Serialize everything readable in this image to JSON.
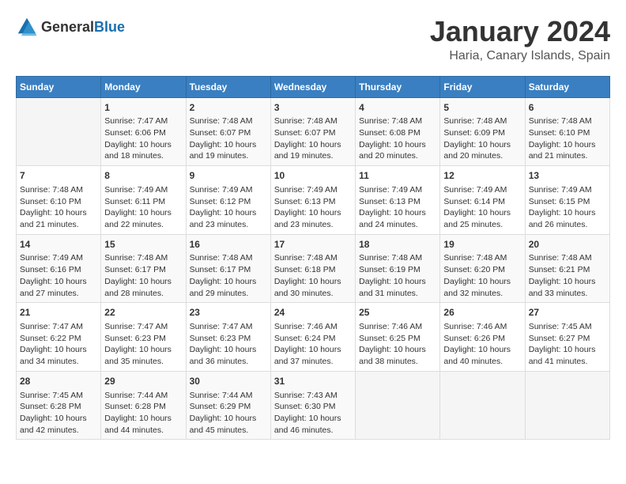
{
  "header": {
    "logo": {
      "general": "General",
      "blue": "Blue"
    },
    "title": "January 2024",
    "subtitle": "Haria, Canary Islands, Spain"
  },
  "weekdays": [
    "Sunday",
    "Monday",
    "Tuesday",
    "Wednesday",
    "Thursday",
    "Friday",
    "Saturday"
  ],
  "weeks": [
    [
      {
        "day": "",
        "info": ""
      },
      {
        "day": "1",
        "info": "Sunrise: 7:47 AM\nSunset: 6:06 PM\nDaylight: 10 hours\nand 18 minutes."
      },
      {
        "day": "2",
        "info": "Sunrise: 7:48 AM\nSunset: 6:07 PM\nDaylight: 10 hours\nand 19 minutes."
      },
      {
        "day": "3",
        "info": "Sunrise: 7:48 AM\nSunset: 6:07 PM\nDaylight: 10 hours\nand 19 minutes."
      },
      {
        "day": "4",
        "info": "Sunrise: 7:48 AM\nSunset: 6:08 PM\nDaylight: 10 hours\nand 20 minutes."
      },
      {
        "day": "5",
        "info": "Sunrise: 7:48 AM\nSunset: 6:09 PM\nDaylight: 10 hours\nand 20 minutes."
      },
      {
        "day": "6",
        "info": "Sunrise: 7:48 AM\nSunset: 6:10 PM\nDaylight: 10 hours\nand 21 minutes."
      }
    ],
    [
      {
        "day": "7",
        "info": "Sunrise: 7:48 AM\nSunset: 6:10 PM\nDaylight: 10 hours\nand 21 minutes."
      },
      {
        "day": "8",
        "info": "Sunrise: 7:49 AM\nSunset: 6:11 PM\nDaylight: 10 hours\nand 22 minutes."
      },
      {
        "day": "9",
        "info": "Sunrise: 7:49 AM\nSunset: 6:12 PM\nDaylight: 10 hours\nand 23 minutes."
      },
      {
        "day": "10",
        "info": "Sunrise: 7:49 AM\nSunset: 6:13 PM\nDaylight: 10 hours\nand 23 minutes."
      },
      {
        "day": "11",
        "info": "Sunrise: 7:49 AM\nSunset: 6:13 PM\nDaylight: 10 hours\nand 24 minutes."
      },
      {
        "day": "12",
        "info": "Sunrise: 7:49 AM\nSunset: 6:14 PM\nDaylight: 10 hours\nand 25 minutes."
      },
      {
        "day": "13",
        "info": "Sunrise: 7:49 AM\nSunset: 6:15 PM\nDaylight: 10 hours\nand 26 minutes."
      }
    ],
    [
      {
        "day": "14",
        "info": "Sunrise: 7:49 AM\nSunset: 6:16 PM\nDaylight: 10 hours\nand 27 minutes."
      },
      {
        "day": "15",
        "info": "Sunrise: 7:48 AM\nSunset: 6:17 PM\nDaylight: 10 hours\nand 28 minutes."
      },
      {
        "day": "16",
        "info": "Sunrise: 7:48 AM\nSunset: 6:17 PM\nDaylight: 10 hours\nand 29 minutes."
      },
      {
        "day": "17",
        "info": "Sunrise: 7:48 AM\nSunset: 6:18 PM\nDaylight: 10 hours\nand 30 minutes."
      },
      {
        "day": "18",
        "info": "Sunrise: 7:48 AM\nSunset: 6:19 PM\nDaylight: 10 hours\nand 31 minutes."
      },
      {
        "day": "19",
        "info": "Sunrise: 7:48 AM\nSunset: 6:20 PM\nDaylight: 10 hours\nand 32 minutes."
      },
      {
        "day": "20",
        "info": "Sunrise: 7:48 AM\nSunset: 6:21 PM\nDaylight: 10 hours\nand 33 minutes."
      }
    ],
    [
      {
        "day": "21",
        "info": "Sunrise: 7:47 AM\nSunset: 6:22 PM\nDaylight: 10 hours\nand 34 minutes."
      },
      {
        "day": "22",
        "info": "Sunrise: 7:47 AM\nSunset: 6:23 PM\nDaylight: 10 hours\nand 35 minutes."
      },
      {
        "day": "23",
        "info": "Sunrise: 7:47 AM\nSunset: 6:23 PM\nDaylight: 10 hours\nand 36 minutes."
      },
      {
        "day": "24",
        "info": "Sunrise: 7:46 AM\nSunset: 6:24 PM\nDaylight: 10 hours\nand 37 minutes."
      },
      {
        "day": "25",
        "info": "Sunrise: 7:46 AM\nSunset: 6:25 PM\nDaylight: 10 hours\nand 38 minutes."
      },
      {
        "day": "26",
        "info": "Sunrise: 7:46 AM\nSunset: 6:26 PM\nDaylight: 10 hours\nand 40 minutes."
      },
      {
        "day": "27",
        "info": "Sunrise: 7:45 AM\nSunset: 6:27 PM\nDaylight: 10 hours\nand 41 minutes."
      }
    ],
    [
      {
        "day": "28",
        "info": "Sunrise: 7:45 AM\nSunset: 6:28 PM\nDaylight: 10 hours\nand 42 minutes."
      },
      {
        "day": "29",
        "info": "Sunrise: 7:44 AM\nSunset: 6:28 PM\nDaylight: 10 hours\nand 44 minutes."
      },
      {
        "day": "30",
        "info": "Sunrise: 7:44 AM\nSunset: 6:29 PM\nDaylight: 10 hours\nand 45 minutes."
      },
      {
        "day": "31",
        "info": "Sunrise: 7:43 AM\nSunset: 6:30 PM\nDaylight: 10 hours\nand 46 minutes."
      },
      {
        "day": "",
        "info": ""
      },
      {
        "day": "",
        "info": ""
      },
      {
        "day": "",
        "info": ""
      }
    ]
  ]
}
